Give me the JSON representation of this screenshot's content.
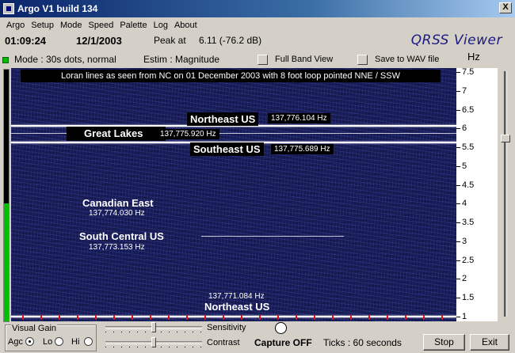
{
  "window": {
    "title": "Argo V1 build 134",
    "close_glyph": "X"
  },
  "menu": [
    "Argo",
    "Setup",
    "Mode",
    "Speed",
    "Palette",
    "Log",
    "About"
  ],
  "status": {
    "time": "01:09:24",
    "date": "12/1/2003",
    "peak_label": "Peak at",
    "peak_value": "6.11 (-76.2 dB)",
    "brand": "QRSS Viewer"
  },
  "mode_row": {
    "mode": "Mode : 30s dots, normal",
    "estim": "Estim : Magnitude",
    "full_band": "Full Band View",
    "save_wav": "Save to WAV file",
    "unit": "Hz"
  },
  "level_meter": {
    "level": 0.47
  },
  "waterfall": {
    "caption": "Loran lines as seen from NC on 01 December 2003 with 8 foot loop pointed NNE / SSW",
    "signals": [
      {
        "name": "Northeast US",
        "freq": "137,776.104 Hz"
      },
      {
        "name": "Great Lakes",
        "freq": "137,775.920 Hz"
      },
      {
        "name": "Southeast US",
        "freq": "137,775.689 Hz"
      },
      {
        "name": "Canadian East",
        "freq": "137,774.030 Hz"
      },
      {
        "name": "South Central US",
        "freq": "137,773.153 Hz"
      },
      {
        "name": "Northeast US",
        "freq": "137,771.084 Hz"
      }
    ]
  },
  "scale": {
    "labels": [
      "7.5",
      "7",
      "6.5",
      "6",
      "5.5",
      "5",
      "4.5",
      "4",
      "3.5",
      "3",
      "2.5",
      "2",
      "1.5",
      "1"
    ]
  },
  "controls": {
    "visual_gain": "Visual Gain",
    "agc": "Agc",
    "lo": "Lo",
    "hi": "Hi",
    "sensitivity": "Sensitivity",
    "contrast": "Contrast",
    "capture": "Capture OFF",
    "ticks": "Ticks  : 60 seconds",
    "stop": "Stop",
    "exit": "Exit"
  },
  "colors": {
    "titlebar": "#0a246a",
    "waterfall_bg": "#161a55",
    "signal": "#ffffff",
    "tick_marker": "#e01010",
    "led": "#00c000"
  }
}
